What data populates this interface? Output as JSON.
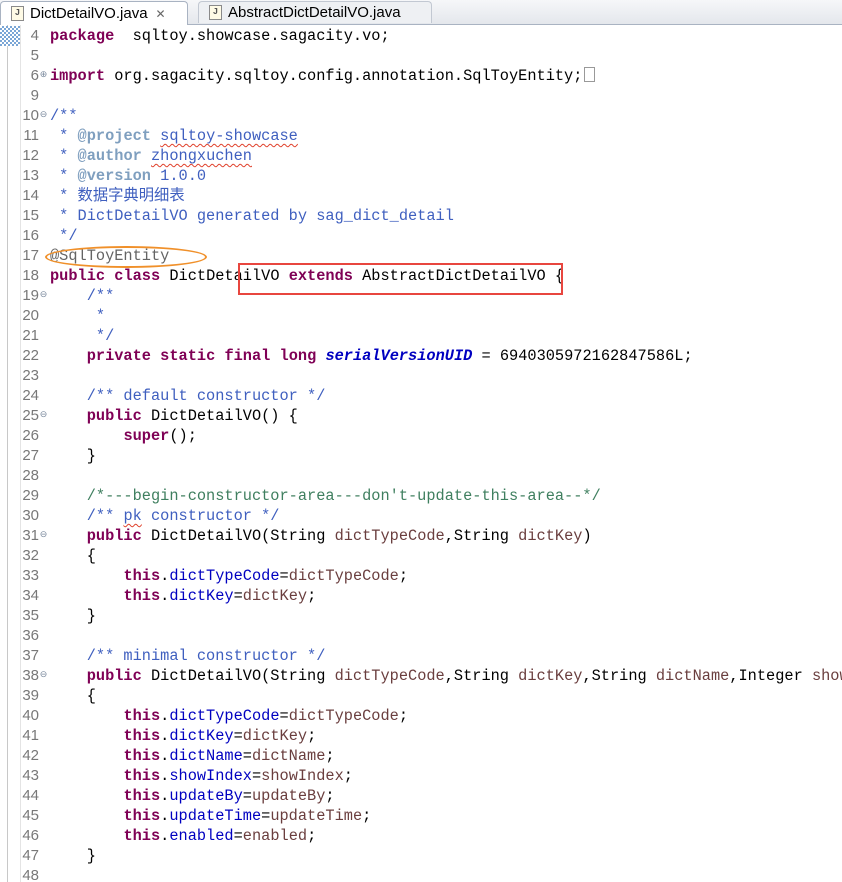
{
  "tabs": [
    {
      "label": "DictDetailVO.java",
      "active": true,
      "close_icon": "✕"
    },
    {
      "label": "AbstractDictDetailVO.java",
      "active": false
    }
  ],
  "file_icon_glyph": "J",
  "lines": [
    {
      "num": "4",
      "t": [
        [
          "k",
          "package"
        ],
        [
          "",
          "  sqltoy.showcase.sagacity.vo;"
        ]
      ]
    },
    {
      "num": "5",
      "t": []
    },
    {
      "num": "6",
      "fold": "plus",
      "collapsed": true,
      "t": [
        [
          "k",
          "import"
        ],
        [
          "",
          " org.sagacity.sqltoy.config.annotation.SqlToyEntity;"
        ]
      ]
    },
    {
      "num": "9",
      "t": []
    },
    {
      "num": "10",
      "fold": "minus",
      "t": [
        [
          "jd",
          "/**"
        ]
      ]
    },
    {
      "num": "11",
      "t": [
        [
          "jd",
          " * "
        ],
        [
          "jt",
          "@project"
        ],
        [
          "jd",
          " "
        ],
        [
          "jd sp",
          "sqltoy-showcase"
        ]
      ]
    },
    {
      "num": "12",
      "t": [
        [
          "jd",
          " * "
        ],
        [
          "jt",
          "@author"
        ],
        [
          "jd",
          " "
        ],
        [
          "jd sp",
          "zhongxuchen"
        ]
      ]
    },
    {
      "num": "13",
      "t": [
        [
          "jd",
          " * "
        ],
        [
          "jt",
          "@version"
        ],
        [
          "jd",
          " 1.0.0"
        ]
      ]
    },
    {
      "num": "14",
      "t": [
        [
          "jd",
          " * 数据字典明细表"
        ]
      ]
    },
    {
      "num": "15",
      "t": [
        [
          "jd",
          " * DictDetailVO generated by sag_dict_detail"
        ]
      ]
    },
    {
      "num": "16",
      "t": [
        [
          "jd",
          " */"
        ]
      ]
    },
    {
      "num": "17",
      "t": [
        [
          "a",
          "@SqlToyEntity"
        ]
      ]
    },
    {
      "num": "18",
      "t": [
        [
          "k",
          "public"
        ],
        [
          "",
          " "
        ],
        [
          "k",
          "class"
        ],
        [
          "",
          " DictDetailVO "
        ],
        [
          "k",
          "extends"
        ],
        [
          "",
          " AbstractDictDetailVO {"
        ]
      ]
    },
    {
      "num": "19",
      "fold": "minus",
      "t": [
        [
          "",
          "    "
        ],
        [
          "jd",
          "/**"
        ]
      ]
    },
    {
      "num": "20",
      "t": [
        [
          "jd",
          "     *"
        ]
      ]
    },
    {
      "num": "21",
      "t": [
        [
          "jd",
          "     */"
        ]
      ]
    },
    {
      "num": "22",
      "t": [
        [
          "",
          "    "
        ],
        [
          "k",
          "private"
        ],
        [
          "",
          " "
        ],
        [
          "k",
          "static"
        ],
        [
          "",
          " "
        ],
        [
          "k",
          "final"
        ],
        [
          "",
          " "
        ],
        [
          "k",
          "long"
        ],
        [
          "",
          " "
        ],
        [
          "sf",
          "serialVersionUID"
        ],
        [
          "",
          " = 6940305972162847586L;"
        ]
      ]
    },
    {
      "num": "23",
      "t": []
    },
    {
      "num": "24",
      "t": [
        [
          "",
          "    "
        ],
        [
          "jd",
          "/** default constructor */"
        ]
      ]
    },
    {
      "num": "25",
      "fold": "minus",
      "t": [
        [
          "",
          "    "
        ],
        [
          "k",
          "public"
        ],
        [
          "",
          " DictDetailVO() {"
        ]
      ]
    },
    {
      "num": "26",
      "t": [
        [
          "",
          "        "
        ],
        [
          "k",
          "super"
        ],
        [
          "",
          "();"
        ]
      ]
    },
    {
      "num": "27",
      "t": [
        [
          "",
          "    }"
        ]
      ]
    },
    {
      "num": "28",
      "t": []
    },
    {
      "num": "29",
      "t": [
        [
          "",
          "    "
        ],
        [
          "c",
          "/*---begin-constructor-area---don't-update-this-area--*/"
        ]
      ]
    },
    {
      "num": "30",
      "t": [
        [
          "",
          "    "
        ],
        [
          "jd",
          "/** "
        ],
        [
          "jd sp",
          "pk"
        ],
        [
          "jd",
          " constructor */"
        ]
      ]
    },
    {
      "num": "31",
      "fold": "minus",
      "t": [
        [
          "",
          "    "
        ],
        [
          "k",
          "public"
        ],
        [
          "",
          " DictDetailVO(String "
        ],
        [
          "p",
          "dictTypeCode"
        ],
        [
          "",
          ",String "
        ],
        [
          "p",
          "dictKey"
        ],
        [
          "",
          ")"
        ]
      ]
    },
    {
      "num": "32",
      "t": [
        [
          "",
          "    {"
        ]
      ]
    },
    {
      "num": "33",
      "t": [
        [
          "",
          "        "
        ],
        [
          "k",
          "this"
        ],
        [
          "",
          "."
        ],
        [
          "f",
          "dictTypeCode"
        ],
        [
          "",
          "="
        ],
        [
          "p",
          "dictTypeCode"
        ],
        [
          "",
          ";"
        ]
      ]
    },
    {
      "num": "34",
      "t": [
        [
          "",
          "        "
        ],
        [
          "k",
          "this"
        ],
        [
          "",
          "."
        ],
        [
          "f",
          "dictKey"
        ],
        [
          "",
          "="
        ],
        [
          "p",
          "dictKey"
        ],
        [
          "",
          ";"
        ]
      ]
    },
    {
      "num": "35",
      "t": [
        [
          "",
          "    }"
        ]
      ]
    },
    {
      "num": "36",
      "t": []
    },
    {
      "num": "37",
      "t": [
        [
          "",
          "    "
        ],
        [
          "jd",
          "/** minimal constructor */"
        ]
      ]
    },
    {
      "num": "38",
      "fold": "minus",
      "t": [
        [
          "",
          "    "
        ],
        [
          "k",
          "public"
        ],
        [
          "",
          " DictDetailVO(String "
        ],
        [
          "p",
          "dictTypeCode"
        ],
        [
          "",
          ",String "
        ],
        [
          "p",
          "dictKey"
        ],
        [
          "",
          ",String "
        ],
        [
          "p",
          "dictName"
        ],
        [
          "",
          ",Integer "
        ],
        [
          "p",
          "showI"
        ]
      ]
    },
    {
      "num": "39",
      "t": [
        [
          "",
          "    {"
        ]
      ]
    },
    {
      "num": "40",
      "t": [
        [
          "",
          "        "
        ],
        [
          "k",
          "this"
        ],
        [
          "",
          "."
        ],
        [
          "f",
          "dictTypeCode"
        ],
        [
          "",
          "="
        ],
        [
          "p",
          "dictTypeCode"
        ],
        [
          "",
          ";"
        ]
      ]
    },
    {
      "num": "41",
      "t": [
        [
          "",
          "        "
        ],
        [
          "k",
          "this"
        ],
        [
          "",
          "."
        ],
        [
          "f",
          "dictKey"
        ],
        [
          "",
          "="
        ],
        [
          "p",
          "dictKey"
        ],
        [
          "",
          ";"
        ]
      ]
    },
    {
      "num": "42",
      "t": [
        [
          "",
          "        "
        ],
        [
          "k",
          "this"
        ],
        [
          "",
          "."
        ],
        [
          "f",
          "dictName"
        ],
        [
          "",
          "="
        ],
        [
          "p",
          "dictName"
        ],
        [
          "",
          ";"
        ]
      ]
    },
    {
      "num": "43",
      "t": [
        [
          "",
          "        "
        ],
        [
          "k",
          "this"
        ],
        [
          "",
          "."
        ],
        [
          "f",
          "showIndex"
        ],
        [
          "",
          "="
        ],
        [
          "p",
          "showIndex"
        ],
        [
          "",
          ";"
        ]
      ]
    },
    {
      "num": "44",
      "t": [
        [
          "",
          "        "
        ],
        [
          "k",
          "this"
        ],
        [
          "",
          "."
        ],
        [
          "f",
          "updateBy"
        ],
        [
          "",
          "="
        ],
        [
          "p",
          "updateBy"
        ],
        [
          "",
          ";"
        ]
      ]
    },
    {
      "num": "45",
      "t": [
        [
          "",
          "        "
        ],
        [
          "k",
          "this"
        ],
        [
          "",
          "."
        ],
        [
          "f",
          "updateTime"
        ],
        [
          "",
          "="
        ],
        [
          "p",
          "updateTime"
        ],
        [
          "",
          ";"
        ]
      ]
    },
    {
      "num": "46",
      "t": [
        [
          "",
          "        "
        ],
        [
          "k",
          "this"
        ],
        [
          "",
          "."
        ],
        [
          "f",
          "enabled"
        ],
        [
          "",
          "="
        ],
        [
          "p",
          "enabled"
        ],
        [
          "",
          ";"
        ]
      ]
    },
    {
      "num": "47",
      "t": [
        [
          "",
          "    }"
        ]
      ]
    },
    {
      "num": "48",
      "t": []
    }
  ],
  "highlight_colors": {
    "ellipse": "#f0902a",
    "rectangle": "#e8463f"
  }
}
